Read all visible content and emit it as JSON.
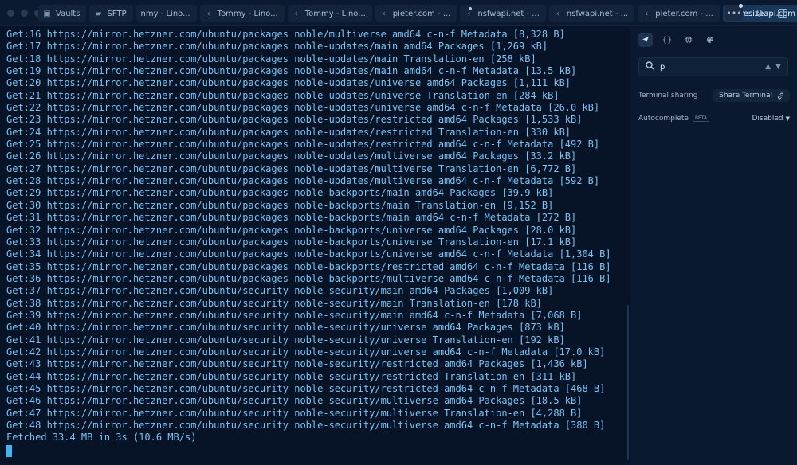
{
  "tabs": [
    {
      "label": "Vaults",
      "icon": "vault-icon",
      "active": false
    },
    {
      "label": "SFTP",
      "icon": "folder-icon",
      "active": false
    },
    {
      "label": "nmy - Lino...",
      "icon": "",
      "active": false
    },
    {
      "label": "Tommy - Lino...",
      "icon": "terminal-icon",
      "active": false
    },
    {
      "label": "Tommy - Lino...",
      "icon": "terminal-icon",
      "active": false
    },
    {
      "label": "pieter.com - ...",
      "icon": "terminal-icon",
      "active": false
    },
    {
      "label": "nsfwapi.net - ...",
      "icon": "terminal-icon",
      "active": false,
      "dot": true
    },
    {
      "label": "nsfwapi.net - ...",
      "icon": "terminal-icon",
      "active": false
    },
    {
      "label": "pieter.com - ...",
      "icon": "terminal-icon",
      "active": false
    },
    {
      "label": "resizeapi.com",
      "icon": "terminal-icon",
      "active": true
    }
  ],
  "terminal": {
    "lines": [
      "Get:16 https://mirror.hetzner.com/ubuntu/packages noble/multiverse amd64 c-n-f Metadata [8,328 B]",
      "Get:17 https://mirror.hetzner.com/ubuntu/packages noble-updates/main amd64 Packages [1,269 kB]",
      "Get:18 https://mirror.hetzner.com/ubuntu/packages noble-updates/main Translation-en [258 kB]",
      "Get:19 https://mirror.hetzner.com/ubuntu/packages noble-updates/main amd64 c-n-f Metadata [13.5 kB]",
      "Get:20 https://mirror.hetzner.com/ubuntu/packages noble-updates/universe amd64 Packages [1,111 kB]",
      "Get:21 https://mirror.hetzner.com/ubuntu/packages noble-updates/universe Translation-en [284 kB]",
      "Get:22 https://mirror.hetzner.com/ubuntu/packages noble-updates/universe amd64 c-n-f Metadata [26.0 kB]",
      "Get:23 https://mirror.hetzner.com/ubuntu/packages noble-updates/restricted amd64 Packages [1,533 kB]",
      "Get:24 https://mirror.hetzner.com/ubuntu/packages noble-updates/restricted Translation-en [330 kB]",
      "Get:25 https://mirror.hetzner.com/ubuntu/packages noble-updates/restricted amd64 c-n-f Metadata [492 B]",
      "Get:26 https://mirror.hetzner.com/ubuntu/packages noble-updates/multiverse amd64 Packages [33.2 kB]",
      "Get:27 https://mirror.hetzner.com/ubuntu/packages noble-updates/multiverse Translation-en [6,772 B]",
      "Get:28 https://mirror.hetzner.com/ubuntu/packages noble-updates/multiverse amd64 c-n-f Metadata [592 B]",
      "Get:29 https://mirror.hetzner.com/ubuntu/packages noble-backports/main amd64 Packages [39.9 kB]",
      "Get:30 https://mirror.hetzner.com/ubuntu/packages noble-backports/main Translation-en [9,152 B]",
      "Get:31 https://mirror.hetzner.com/ubuntu/packages noble-backports/main amd64 c-n-f Metadata [272 B]",
      "Get:32 https://mirror.hetzner.com/ubuntu/packages noble-backports/universe amd64 Packages [28.0 kB]",
      "Get:33 https://mirror.hetzner.com/ubuntu/packages noble-backports/universe Translation-en [17.1 kB]",
      "Get:34 https://mirror.hetzner.com/ubuntu/packages noble-backports/universe amd64 c-n-f Metadata [1,304 B]",
      "Get:35 https://mirror.hetzner.com/ubuntu/packages noble-backports/restricted amd64 c-n-f Metadata [116 B]",
      "Get:36 https://mirror.hetzner.com/ubuntu/packages noble-backports/multiverse amd64 c-n-f Metadata [116 B]",
      "Get:37 https://mirror.hetzner.com/ubuntu/security noble-security/main amd64 Packages [1,009 kB]",
      "Get:38 https://mirror.hetzner.com/ubuntu/security noble-security/main Translation-en [178 kB]",
      "Get:39 https://mirror.hetzner.com/ubuntu/security noble-security/main amd64 c-n-f Metadata [7,068 B]",
      "Get:40 https://mirror.hetzner.com/ubuntu/security noble-security/universe amd64 Packages [873 kB]",
      "Get:41 https://mirror.hetzner.com/ubuntu/security noble-security/universe Translation-en [192 kB]",
      "Get:42 https://mirror.hetzner.com/ubuntu/security noble-security/universe amd64 c-n-f Metadata [17.0 kB]",
      "Get:43 https://mirror.hetzner.com/ubuntu/security noble-security/restricted amd64 Packages [1,436 kB]",
      "Get:44 https://mirror.hetzner.com/ubuntu/security noble-security/restricted Translation-en [311 kB]",
      "Get:45 https://mirror.hetzner.com/ubuntu/security noble-security/restricted amd64 c-n-f Metadata [468 B]",
      "Get:46 https://mirror.hetzner.com/ubuntu/security noble-security/multiverse amd64 Packages [18.5 kB]",
      "Get:47 https://mirror.hetzner.com/ubuntu/security noble-security/multiverse Translation-en [4,288 B]",
      "Get:48 https://mirror.hetzner.com/ubuntu/security noble-security/multiverse amd64 c-n-f Metadata [380 B]",
      "Fetched 33.4 MB in 3s (10.6 MB/s)"
    ]
  },
  "panel": {
    "search": {
      "value": "p",
      "placeholder": ""
    },
    "terminal_sharing": {
      "label": "Terminal sharing",
      "button": "Share Terminal"
    },
    "autocomplete": {
      "label": "Autocomplete",
      "badge": "BETA",
      "value": "Disabled"
    }
  },
  "colors": {
    "background": "#071327",
    "terminal_text": "#7cc2f2",
    "cursor": "#3fb6ef",
    "active_tab": "#17375b"
  }
}
